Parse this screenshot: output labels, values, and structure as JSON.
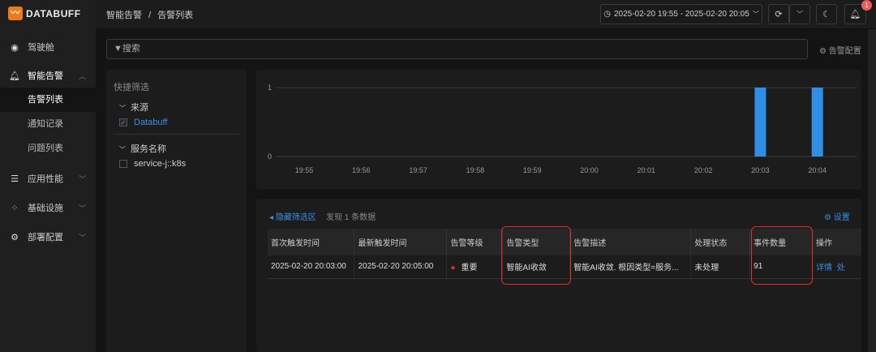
{
  "brand": "DATABUFF",
  "sidebar": {
    "items": [
      {
        "label": "驾驶舱",
        "icon": "cockpit-icon"
      },
      {
        "label": "智能告警",
        "icon": "bell-icon",
        "children": [
          "告警列表",
          "通知记录",
          "问题列表"
        ]
      },
      {
        "label": "应用性能",
        "icon": "apm-icon"
      },
      {
        "label": "基础设施",
        "icon": "infra-icon"
      },
      {
        "label": "部署配置",
        "icon": "gear-icon"
      }
    ]
  },
  "header": {
    "breadcrumb": [
      "智能告警",
      "告警列表"
    ],
    "separator": "/",
    "time_range": "2025-02-20 19:55 - 2025-02-20 20:05",
    "notification_count": "1"
  },
  "search": {
    "placeholder": "搜索"
  },
  "alert_config": "告警配置",
  "filters": {
    "title": "快捷筛选",
    "groups": [
      {
        "label": "来源",
        "options": [
          {
            "label": "Databuff",
            "checked": true
          }
        ]
      },
      {
        "label": "服务名称",
        "options": [
          {
            "label": "service-j::k8s",
            "checked": false
          }
        ]
      }
    ]
  },
  "chart_data": {
    "type": "bar",
    "x": [
      "19:55",
      "19:56",
      "19:57",
      "19:58",
      "19:59",
      "20:00",
      "20:01",
      "20:02",
      "20:03",
      "20:04"
    ],
    "values": [
      0,
      0,
      0,
      0,
      0,
      0,
      0,
      0,
      1,
      1
    ],
    "yticks": [
      "0",
      "1"
    ],
    "ylim": [
      0,
      1
    ],
    "color": "#2f8fe6"
  },
  "table": {
    "hide_filter": "隐藏筛选区",
    "found": "发现 1 条数据",
    "settings": "设置",
    "columns": [
      "首次触发时间",
      "最新触发时间",
      "告警等级",
      "告警类型",
      "告警描述",
      "处理状态",
      "事件数量",
      "操作"
    ],
    "rows": [
      {
        "first": "2025-02-20 20:03:00",
        "latest": "2025-02-20 20:05:00",
        "level": "重要",
        "type": "智能AI收敛",
        "desc": "智能AI收敛. 根因类型=服务...",
        "status": "未处理",
        "count": "91",
        "actions": [
          "详情",
          "处"
        ]
      }
    ]
  }
}
